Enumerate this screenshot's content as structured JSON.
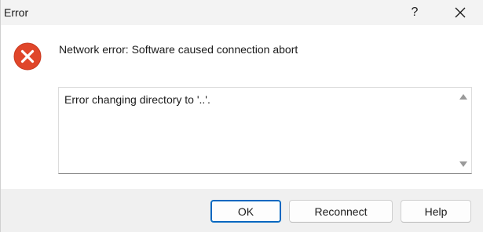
{
  "window": {
    "title": "Error",
    "help_glyph": "?",
    "close_glyph": "✕"
  },
  "dialog": {
    "icon": "error-circle-x-icon",
    "message": "Network error: Software caused connection abort",
    "detail": "Error changing directory to '..'."
  },
  "buttons": {
    "ok": "OK",
    "reconnect": "Reconnect",
    "help": "Help"
  },
  "colors": {
    "error_icon": "#e0462a",
    "default_button_border": "#0067c0",
    "footer_bg": "#f0f0f0"
  }
}
